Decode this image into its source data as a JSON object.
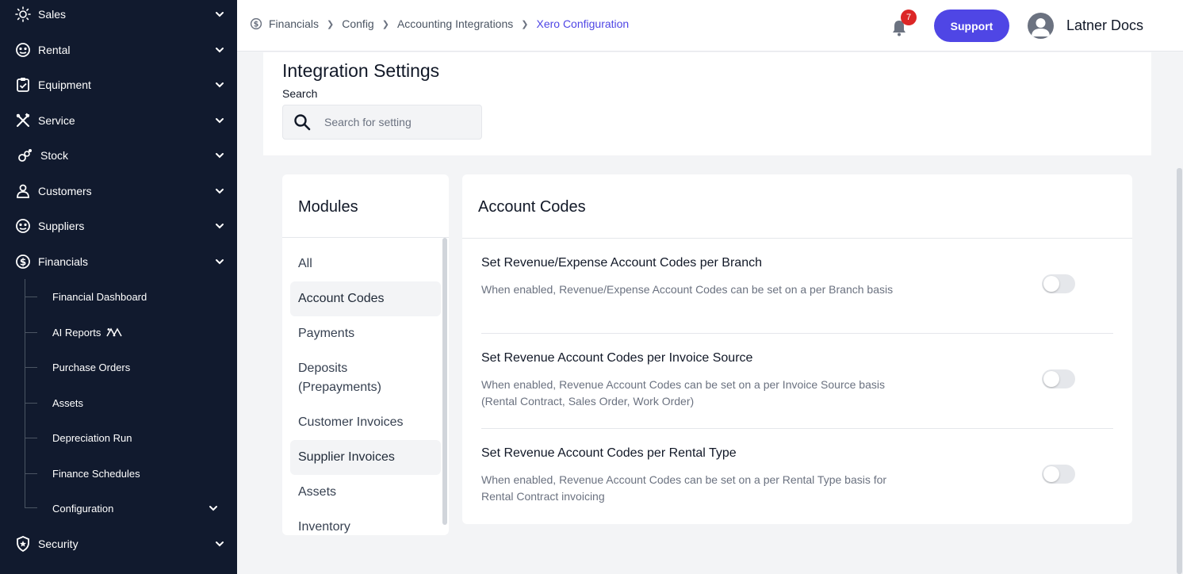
{
  "sidebar": {
    "items": [
      {
        "label": "Sales",
        "icon": "sun-icon"
      },
      {
        "label": "Rental",
        "icon": "rental-icon"
      },
      {
        "label": "Equipment",
        "icon": "clipboard-icon"
      },
      {
        "label": "Service",
        "icon": "tools-icon"
      },
      {
        "label": "Stock",
        "icon": "stock-icon"
      },
      {
        "label": "Customers",
        "icon": "user-icon"
      },
      {
        "label": "Suppliers",
        "icon": "suppliers-icon"
      },
      {
        "label": "Financials",
        "icon": "financials-icon"
      },
      {
        "label": "Security",
        "icon": "shield-icon"
      }
    ],
    "financials_sub": [
      "Financial Dashboard",
      "AI Reports",
      "Purchase Orders",
      "Assets",
      "Depreciation Run",
      "Finance Schedules",
      "Configuration"
    ]
  },
  "header": {
    "breadcrumbs": [
      "Financials",
      "Config",
      "Accounting Integrations",
      "Xero Configuration"
    ],
    "notifications": "7",
    "support_label": "Support",
    "user_name": "Latner Docs"
  },
  "settings": {
    "title": "Integration Settings",
    "search_label": "Search",
    "search_placeholder": "Search for setting"
  },
  "modules": {
    "title": "Modules",
    "items": [
      "All",
      "Account Codes",
      "Payments",
      "Deposits (Prepayments)",
      "Customer Invoices",
      "Supplier Invoices",
      "Assets",
      "Inventory"
    ],
    "selected": "Account Codes"
  },
  "account_codes": {
    "title": "Account Codes",
    "settings": [
      {
        "title": "Set Revenue/Expense Account Codes per Branch",
        "description": "When enabled, Revenue/Expense Account Codes can be set on a per Branch basis",
        "enabled": false
      },
      {
        "title": "Set Revenue Account Codes per Invoice Source",
        "description": "When enabled, Revenue Account Codes can be set on a per Invoice Source basis (Rental Contract, Sales Order, Work Order)",
        "enabled": false
      },
      {
        "title": "Set Revenue Account Codes per Rental Type",
        "description": "When enabled, Revenue Account Codes can be set on a per Rental Type basis for Rental Contract invoicing",
        "enabled": false
      }
    ]
  },
  "colors": {
    "sidebar_bg": "#111a2e",
    "accent": "#4f46e5",
    "badge": "#dc2626"
  }
}
